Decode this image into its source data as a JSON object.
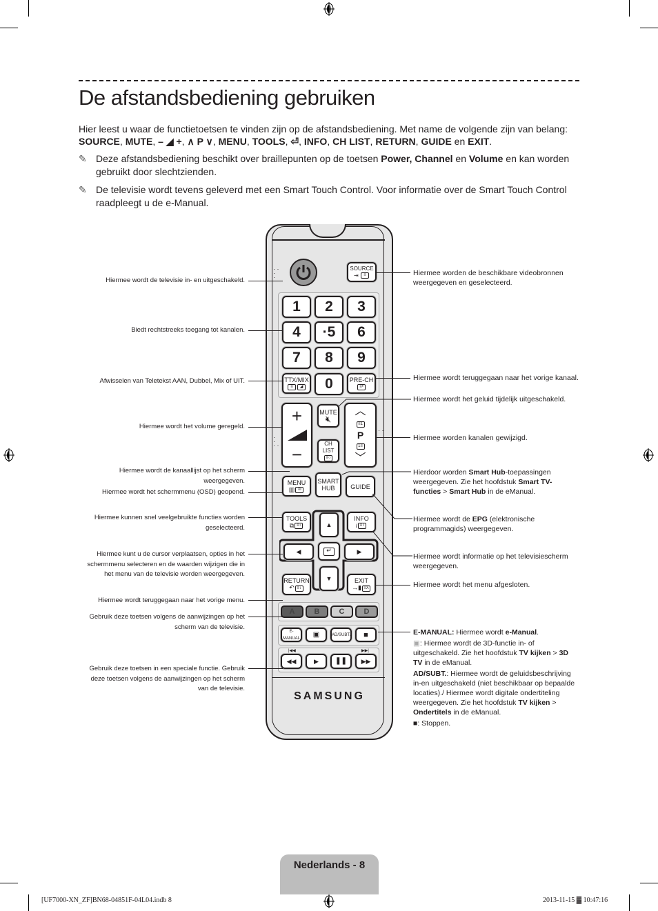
{
  "page": {
    "title": "De afstandsbediening gebruiken",
    "intro_line1": "Hier leest u waar de functietoetsen te vinden zijn op de afstandsbediening. Met name de volgende zijn van belang:",
    "intro_keys": [
      {
        "text": "SOURCE",
        "bold": true
      },
      {
        "text": ", ",
        "bold": false
      },
      {
        "text": "MUTE",
        "bold": true
      },
      {
        "text": ", ",
        "bold": false
      },
      {
        "text": "– ◢ +",
        "bold": true
      },
      {
        "text": ", ",
        "bold": false
      },
      {
        "text": "∧ P ∨",
        "bold": true
      },
      {
        "text": ", ",
        "bold": false
      },
      {
        "text": "MENU",
        "bold": true
      },
      {
        "text": ", ",
        "bold": false
      },
      {
        "text": "TOOLS",
        "bold": true
      },
      {
        "text": ", ",
        "bold": false
      },
      {
        "text": "⏎",
        "bold": true
      },
      {
        "text": ", ",
        "bold": false
      },
      {
        "text": "INFO",
        "bold": true
      },
      {
        "text": ", ",
        "bold": false
      },
      {
        "text": "CH LIST",
        "bold": true
      },
      {
        "text": ", ",
        "bold": false
      },
      {
        "text": "RETURN",
        "bold": true
      },
      {
        "text": ", ",
        "bold": false
      },
      {
        "text": "GUIDE",
        "bold": true
      },
      {
        "text": " en ",
        "bold": false
      },
      {
        "text": "EXIT",
        "bold": true
      },
      {
        "text": ".",
        "bold": false
      }
    ],
    "note_icon": "pencil-note-icon",
    "notes": [
      [
        {
          "text": "Deze afstandsbediening beschikt over braillepunten op de toetsen ",
          "bold": false
        },
        {
          "text": "Power, Channel",
          "bold": true
        },
        {
          "text": " en ",
          "bold": false
        },
        {
          "text": "Volume",
          "bold": true
        },
        {
          "text": " en kan worden gebruikt door slechtzienden.",
          "bold": false
        }
      ],
      [
        {
          "text": "De televisie wordt tevens geleverd met een Smart Touch Control. Voor informatie over de Smart Touch Control raadpleegt u de e-Manual.",
          "bold": false
        }
      ]
    ]
  },
  "remote": {
    "source": {
      "label": "SOURCE"
    },
    "numbers": [
      "1",
      "2",
      "3",
      "4",
      "·5",
      "6",
      "7",
      "8",
      "9",
      "0"
    ],
    "ttx": {
      "label": "TTX/MIX"
    },
    "prech": {
      "label": "PRE-CH"
    },
    "mute": {
      "label": "MUTE"
    },
    "chlist": {
      "label": "CH LIST"
    },
    "vol_plus": "+",
    "vol_minus": "−",
    "channel": {
      "label": "P"
    },
    "menu": {
      "label": "MENU"
    },
    "smarthub": {
      "label_1": "SMART",
      "label_2": "HUB"
    },
    "guide": {
      "label": "GUIDE"
    },
    "tools": {
      "label": "TOOLS"
    },
    "info": {
      "label": "INFO"
    },
    "return": {
      "label": "RETURN"
    },
    "exit": {
      "label": "EXIT"
    },
    "color_buttons": [
      {
        "label": "A",
        "color": "#5a5a5a"
      },
      {
        "label": "B",
        "color": "#7d7d7d"
      },
      {
        "label": "C",
        "color": "#cfcfcf"
      },
      {
        "label": "D",
        "color": "#9a9a9a"
      }
    ],
    "emanual": {
      "label": "E-MANUAL"
    },
    "adsubt": {
      "label": "AD/SUBT."
    },
    "brand": "SAMSUNG"
  },
  "callouts_left": [
    {
      "text": "Hiermee wordt de televisie in- en uitgeschakeld."
    },
    {
      "text": "Biedt rechtstreeks toegang tot kanalen."
    },
    {
      "text": "Afwisselen van Teletekst AAN, Dubbel, Mix of UIT."
    },
    {
      "text": "Hiermee wordt het volume geregeld."
    },
    {
      "text": "Hiermee wordt de kanaallijst op het scherm weergegeven."
    },
    {
      "text": "Hiermee wordt het schermmenu (OSD) geopend."
    },
    {
      "text": "Hiermee kunnen snel veelgebruikte functies worden geselecteerd."
    },
    {
      "text": "Hiermee kunt u de cursor verplaatsen, opties in het schermmenu selecteren en de waarden wijzigen die in het menu van de televisie worden weergegeven."
    },
    {
      "text": "Hiermee wordt teruggegaan naar het vorige menu."
    },
    {
      "text": "Gebruik deze toetsen volgens de aanwijzingen op het scherm van de televisie."
    },
    {
      "text": "Gebruik deze toetsen in een speciale functie. Gebruik deze toetsen volgens de aanwijzingen op het scherm van de televisie."
    }
  ],
  "callouts_right": {
    "source": "Hiermee worden de beschikbare videobronnen weergegeven en geselecteerd.",
    "prech": "Hiermee wordt teruggegaan naar het vorige kanaal.",
    "mute": "Hiermee wordt het geluid tijdelijk uitgeschakeld.",
    "channel": "Hiermee worden kanalen gewijzigd.",
    "smarthub": [
      {
        "text": "Hierdoor worden ",
        "bold": false
      },
      {
        "text": "Smart Hub",
        "bold": true
      },
      {
        "text": "-toepassingen weergegeven. Zie het hoofdstuk ",
        "bold": false
      },
      {
        "text": "Smart TV-functies",
        "bold": true
      },
      {
        "text": " > ",
        "bold": false
      },
      {
        "text": "Smart Hub",
        "bold": true
      },
      {
        "text": " in de eManual.",
        "bold": false
      }
    ],
    "guide": [
      {
        "text": "Hiermee wordt de ",
        "bold": false
      },
      {
        "text": "EPG",
        "bold": true
      },
      {
        "text": " (elektronische programmagids) weergegeven.",
        "bold": false
      }
    ],
    "info": "Hiermee wordt informatie op het televisiescherm weergegeven.",
    "exit": "Hiermee wordt het menu afgesloten.",
    "emanual": [
      {
        "text": "E-MANUAL:",
        "bold": true
      },
      {
        "text": " Hiermee wordt ",
        "bold": false
      },
      {
        "text": "e-Manual",
        "bold": true
      },
      {
        "text": ".",
        "bold": false
      }
    ],
    "threed": [
      {
        "text": ": Hiermee wordt de 3D-functie in- of uitgeschakeld. Zie het hoofdstuk ",
        "bold": false
      },
      {
        "text": "TV kijken",
        "bold": true
      },
      {
        "text": " > ",
        "bold": false
      },
      {
        "text": "3D TV",
        "bold": true
      },
      {
        "text": " in de eManual.",
        "bold": false
      }
    ],
    "adsubt": [
      {
        "text": "AD/SUBT.",
        "bold": true
      },
      {
        "text": ": Hiermee wordt de geluidsbeschrijving in-en uitgeschakeld (niet beschikbaar op bepaalde locaties)./ Hiermee wordt digitale ondertiteling weergegeven. Zie het hoofdstuk ",
        "bold": false
      },
      {
        "text": "TV kijken",
        "bold": true
      },
      {
        "text": " > ",
        "bold": false
      },
      {
        "text": "Ondertitels",
        "bold": true
      },
      {
        "text": " in de eManual.",
        "bold": false
      }
    ],
    "stop": ": Stoppen."
  },
  "footer": {
    "page_label": "Nederlands - 8",
    "file": "[UF7000-XN_ZF]BN68-04851F-04L04.indb   8",
    "date": "2013-11-15   ▓ 10:47:16"
  }
}
